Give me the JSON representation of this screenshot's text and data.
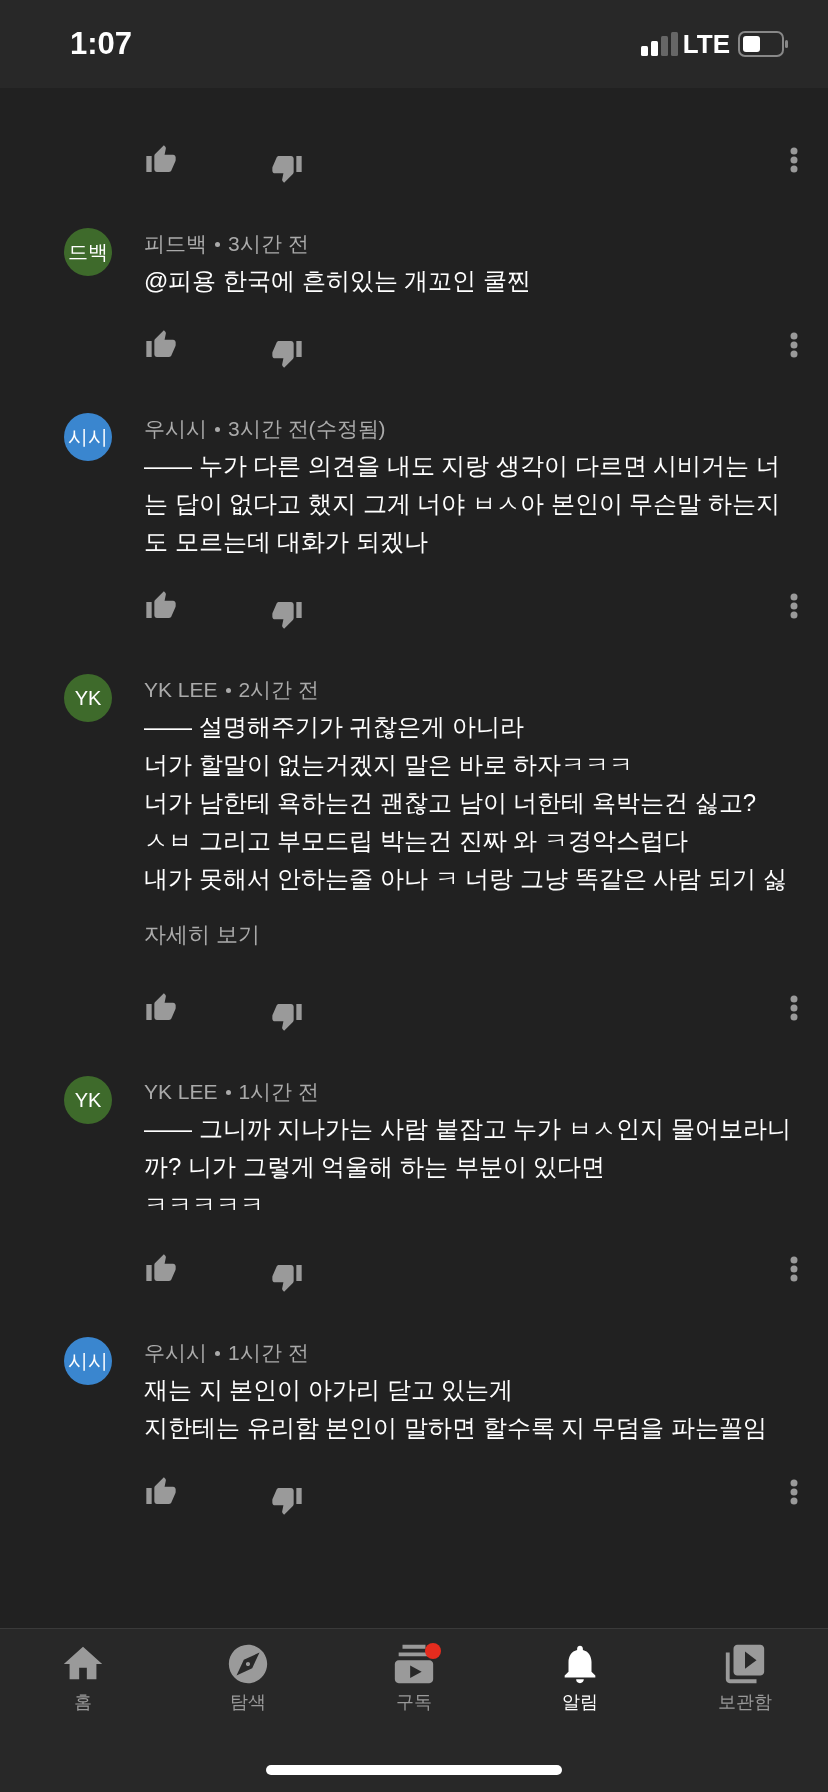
{
  "status_bar": {
    "time": "1:07",
    "network": "LTE"
  },
  "comments": [
    {
      "kind": "partial"
    },
    {
      "kind": "comment",
      "avatar": "드백",
      "color": "#3e6a2b",
      "author": "피드백",
      "time": "3시간 전",
      "body": "@피용 한국에 흔히있는 개꼬인 쿨찐"
    },
    {
      "kind": "comment",
      "avatar": "시시",
      "color": "#3a86cf",
      "author": "우시시",
      "time": "3시간 전(수정됨)",
      "body": "—— 누가 다른 의견을 내도 지랑 생각이 다르면 시비거는 너는 답이 없다고 했지 그게 너야 ㅂㅅ아 본인이 무슨말 하는지도 모르는데 대화가 되겠나"
    },
    {
      "kind": "comment",
      "avatar": "YK",
      "color": "#3e6a2b",
      "author": "YK LEE",
      "time": "2시간 전",
      "body": "—— 설명해주기가 귀찮은게 아니라\n너가 할말이 없는거겠지 말은 바로 하자ㅋㅋㅋ\n너가 남한테 욕하는건 괜찮고 남이 너한테 욕박는건 싫고?\nㅅㅂ 그리고 부모드립 박는건 진짜 와 ㅋ경악스럽다\n내가 못해서 안하는줄 아나 ㅋ 너랑 그냥 똑같은 사람 되기 싫",
      "more": "자세히 보기"
    },
    {
      "kind": "comment",
      "avatar": "YK",
      "color": "#3e6a2b",
      "author": "YK LEE",
      "time": "1시간 전",
      "body": "—— 그니까 지나가는 사람 붙잡고 누가 ㅂㅅ인지 물어보라니까? 니가 그렇게 억울해 하는 부분이 있다면\nㅋㅋㅋㅋㅋ"
    },
    {
      "kind": "comment",
      "avatar": "시시",
      "color": "#3a86cf",
      "author": "우시시",
      "time": "1시간 전",
      "body": "재는 지 본인이 아가리 닫고 있는게\n지한테는 유리함 본인이 말하면 할수록 지 무덤을 파는꼴임"
    }
  ],
  "nav": [
    {
      "kind": "home",
      "label": "홈",
      "selected": false,
      "badge": false
    },
    {
      "kind": "explore",
      "label": "탐색",
      "selected": false,
      "badge": false
    },
    {
      "kind": "subscriptions",
      "label": "구독",
      "selected": false,
      "badge": true
    },
    {
      "kind": "notifications",
      "label": "알림",
      "selected": true,
      "badge": false
    },
    {
      "kind": "library",
      "label": "보관함",
      "selected": false,
      "badge": false
    }
  ]
}
